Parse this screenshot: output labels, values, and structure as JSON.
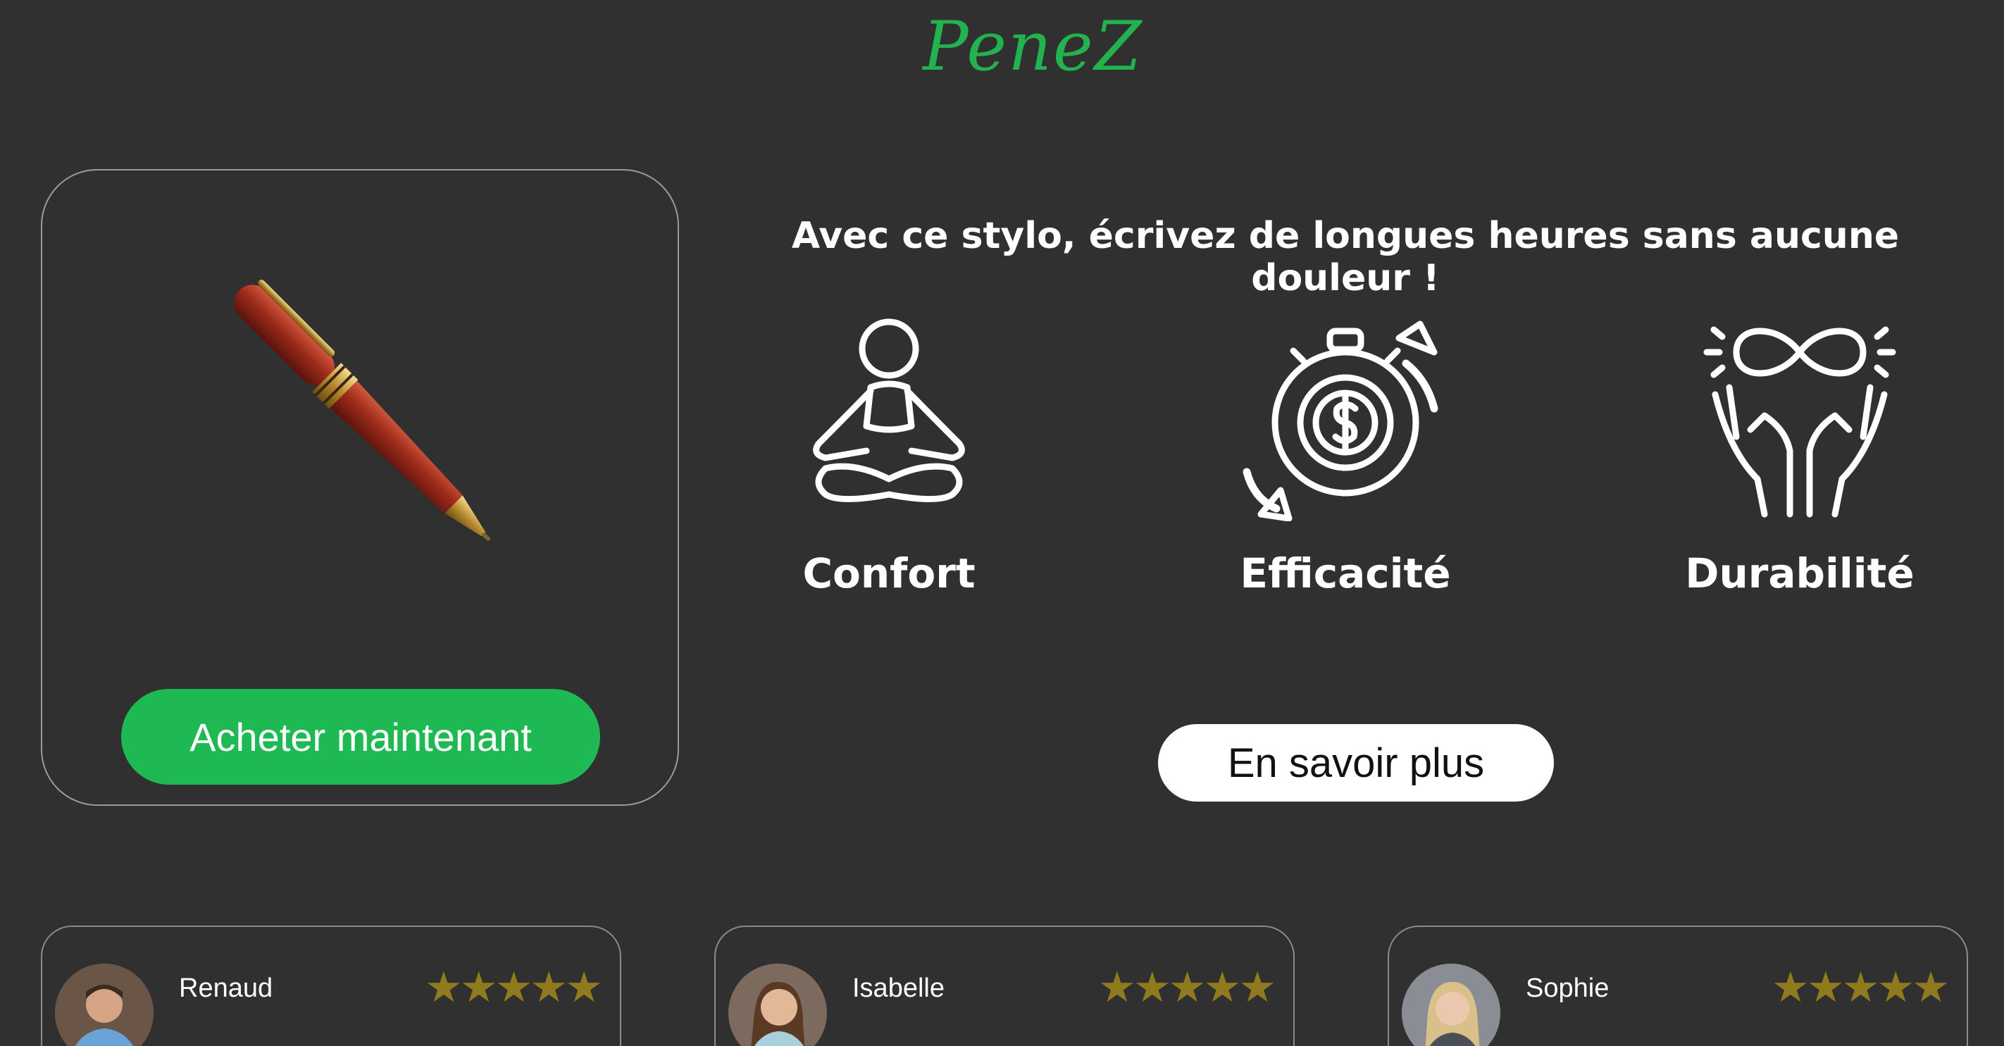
{
  "brand": {
    "logo_text": "PeneZ",
    "logo_color": "#22b24f"
  },
  "hero": {
    "headline": "Avec ce stylo, écrivez de longues heures sans aucune douleur !",
    "buy_button_label": "Acheter maintenant",
    "more_button_label": "En savoir plus",
    "features": [
      {
        "label": "Confort",
        "icon": "meditation-icon"
      },
      {
        "label": "Efficacité",
        "icon": "money-stopwatch-icon"
      },
      {
        "label": "Durabilité",
        "icon": "infinity-hands-icon"
      }
    ]
  },
  "reviews": [
    {
      "name": "Renaud",
      "rating": 5,
      "stars": "★★★★★"
    },
    {
      "name": "Isabelle",
      "rating": 5,
      "stars": "★★★★★"
    },
    {
      "name": "Sophie",
      "rating": 5,
      "stars": "★★★★★"
    }
  ],
  "colors": {
    "background": "#303030",
    "accent_green": "#1fb954",
    "star_gold": "#8f7b1d"
  }
}
